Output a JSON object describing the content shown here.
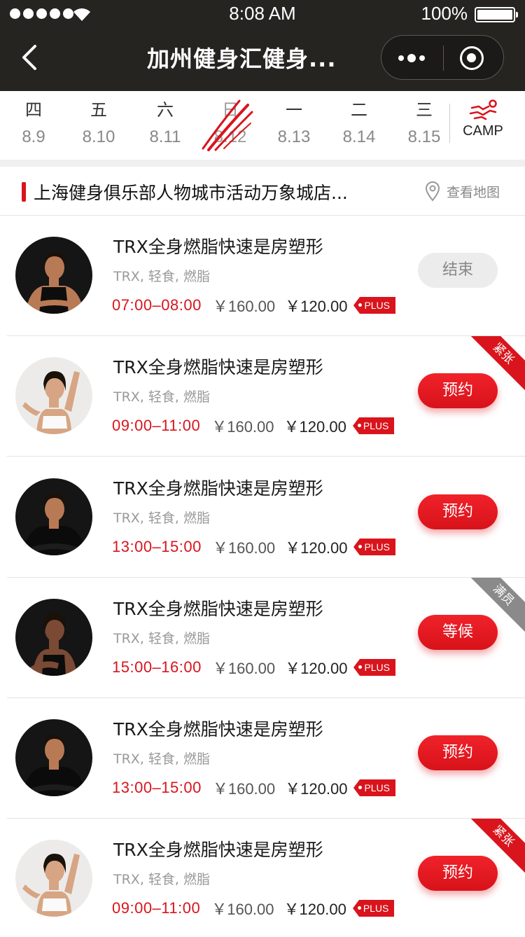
{
  "status_bar": {
    "time": "8:08 AM",
    "battery": "100%"
  },
  "nav": {
    "title": "加州健身汇健身..."
  },
  "dates": [
    {
      "weekday": "四",
      "date": "8.9",
      "active": false
    },
    {
      "weekday": "五",
      "date": "8.10",
      "active": false
    },
    {
      "weekday": "六",
      "date": "8.11",
      "active": false
    },
    {
      "weekday": "日",
      "date": "8.12",
      "active": true
    },
    {
      "weekday": "一",
      "date": "8.13",
      "active": false
    },
    {
      "weekday": "二",
      "date": "8.14",
      "active": false
    },
    {
      "weekday": "三",
      "date": "8.15",
      "active": false
    }
  ],
  "camp": {
    "label": "CAMP"
  },
  "store": {
    "name": "上海健身俱乐部人物城市活动万象城店...",
    "map_label": "查看地图"
  },
  "courses": [
    {
      "title": "TRX全身燃脂快速是房塑形",
      "tags": "TRX, 轻食, 燃脂",
      "time": "07:00–08:00",
      "price": "￥160.00",
      "plus_price": "￥120.00",
      "plus_tag": "PLUS",
      "action": "结束",
      "action_state": "ended",
      "ribbon": "",
      "avatar": "man-tank"
    },
    {
      "title": "TRX全身燃脂快速是房塑形",
      "tags": "TRX, 轻食, 燃脂",
      "time": "09:00–11:00",
      "price": "￥160.00",
      "plus_price": "￥120.00",
      "plus_tag": "PLUS",
      "action": "预约",
      "action_state": "active",
      "ribbon": "紧张",
      "ribbon_color": "red",
      "avatar": "woman-light"
    },
    {
      "title": "TRX全身燃脂快速是房塑形",
      "tags": "TRX, 轻食, 燃脂",
      "time": "13:00–15:00",
      "price": "￥160.00",
      "plus_price": "￥120.00",
      "plus_tag": "PLUS",
      "action": "预约",
      "action_state": "active",
      "ribbon": "",
      "avatar": "man-tshirt"
    },
    {
      "title": "TRX全身燃脂快速是房塑形",
      "tags": "TRX, 轻食, 燃脂",
      "time": "15:00–16:00",
      "price": "￥160.00",
      "plus_price": "￥120.00",
      "plus_tag": "PLUS",
      "action": "等候",
      "action_state": "active",
      "ribbon": "满员",
      "ribbon_color": "grey",
      "avatar": "woman-dark"
    },
    {
      "title": "TRX全身燃脂快速是房塑形",
      "tags": "TRX, 轻食, 燃脂",
      "time": "13:00–15:00",
      "price": "￥160.00",
      "plus_price": "￥120.00",
      "plus_tag": "PLUS",
      "action": "预约",
      "action_state": "active",
      "ribbon": "",
      "avatar": "man-tshirt"
    },
    {
      "title": "TRX全身燃脂快速是房塑形",
      "tags": "TRX, 轻食, 燃脂",
      "time": "09:00–11:00",
      "price": "￥160.00",
      "plus_price": "￥120.00",
      "plus_tag": "PLUS",
      "action": "预约",
      "action_state": "active",
      "ribbon": "紧张",
      "ribbon_color": "red",
      "avatar": "woman-light"
    }
  ],
  "colors": {
    "accent": "#d9141c",
    "nav_bg": "#262421",
    "ribbon_grey": "#8a8a8a"
  }
}
